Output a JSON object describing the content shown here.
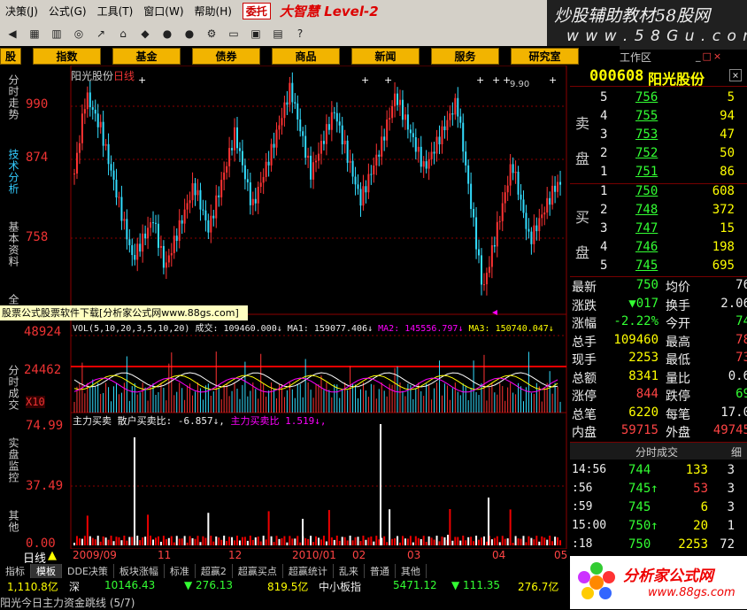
{
  "menu": {
    "items": [
      "决策(J)",
      "公式(G)",
      "工具(T)",
      "窗口(W)",
      "帮助(H)"
    ],
    "wt_label": "委托",
    "brand": "大智慧 Level-2"
  },
  "logo": {
    "line1": "炒股辅助教材58股网",
    "line2": "w w w . 5 8 G u . c o m"
  },
  "nav": {
    "items": [
      "股",
      "指数",
      "基金",
      "债券",
      "商品",
      "新闻",
      "服务",
      "研究室"
    ],
    "workspace": "工作区"
  },
  "side_tabs": [
    "分时走势",
    "技术分析",
    "基本资料",
    "全",
    "分时成交",
    "实盘监控",
    "其他"
  ],
  "chart_header": {
    "name": "阳光股份",
    "period": "日线",
    "peak_label": "9.90"
  },
  "axis": {
    "price_ticks": [
      "990",
      "874",
      "758"
    ],
    "vol_ticks": [
      "48924",
      "24462",
      "X10"
    ],
    "ind_ticks": [
      "74.99",
      "37.49",
      "0.00"
    ]
  },
  "watermark": "股票公式股票软件下载[分析家公式网www.88gs.com]",
  "vol_legend": {
    "vol": "VOL(5,10,20,3,5,10,20) 成交: 109460.000↓",
    "ma1": "MA1: 159077.406↓",
    "ma2": "MA2: 145556.797↓",
    "ma3": "MA3: 150740.047↓"
  },
  "ind_legend": {
    "title": "主力买卖",
    "retail": "散户买卖比: -6.857↓,",
    "main": "主力买卖比  1.519↓,"
  },
  "time_labels": [
    "2009/09",
    "11",
    "12",
    "2010/01",
    "02",
    "03",
    "04",
    "05"
  ],
  "period_label": "日线",
  "bottom_tabs": [
    "指标",
    "模板",
    "DDE决策",
    "板块涨幅",
    "标准",
    "超赢2",
    "超赢买点",
    "超赢统计",
    "乱来",
    "普通",
    "其他"
  ],
  "status": {
    "sh_amt": "1,110.8亿",
    "sz_label": "深",
    "sz_idx": "10146.43",
    "sz_chg": "▼ 276.13",
    "sz_amt": "819.5亿",
    "zx_label": "中小板指",
    "zx_idx": "5471.12",
    "zx_chg": "▼ 111.35",
    "zx_amt": "276.7亿",
    "ticker_text": "阳光今日主力资金跳线 (5/7)"
  },
  "quote": {
    "code": "000608",
    "name": "阳光股份",
    "sell_label": "卖盘",
    "buy_label": "买盘",
    "sell": [
      {
        "n": "5",
        "p": "756",
        "v": "5"
      },
      {
        "n": "4",
        "p": "755",
        "v": "94"
      },
      {
        "n": "3",
        "p": "753",
        "v": "47"
      },
      {
        "n": "2",
        "p": "752",
        "v": "50"
      },
      {
        "n": "1",
        "p": "751",
        "v": "86"
      }
    ],
    "buy": [
      {
        "n": "1",
        "p": "750",
        "v": "608"
      },
      {
        "n": "2",
        "p": "748",
        "v": "372"
      },
      {
        "n": "3",
        "p": "747",
        "v": "15"
      },
      {
        "n": "4",
        "p": "746",
        "v": "198"
      },
      {
        "n": "5",
        "p": "745",
        "v": "695"
      }
    ],
    "stats": [
      {
        "k1": "最新",
        "v1": "750",
        "k2": "均价",
        "v2": "76"
      },
      {
        "k1": "涨跌",
        "v1": "▼017",
        "k2": "换手",
        "v2": "2.06"
      },
      {
        "k1": "涨幅",
        "v1": "-2.22%",
        "k2": "今开",
        "v2": "74"
      },
      {
        "k1": "总手",
        "v1": "109460",
        "k2": "最高",
        "v2": "78"
      },
      {
        "k1": "现手",
        "v1": "2253",
        "k2": "最低",
        "v2": "73"
      },
      {
        "k1": "总额",
        "v1": "8341",
        "k2": "量比",
        "v2": "0.6"
      },
      {
        "k1": "涨停",
        "v1": "844",
        "k2": "跌停",
        "v2": "69"
      },
      {
        "k1": "总笔",
        "v1": "6220",
        "k2": "每笔",
        "v2": "17.0"
      },
      {
        "k1": "内盘",
        "v1": "59715",
        "k2": "外盘",
        "v2": "49745"
      }
    ],
    "tick_title": "分时成交",
    "tick_tab2": "细",
    "ticks": [
      {
        "t": "14:56",
        "p": "744",
        "v": "133",
        "n": "3"
      },
      {
        "t": ":56",
        "p": "745↑",
        "v": "53",
        "n": "3"
      },
      {
        "t": ":59",
        "p": "745",
        "v": "6",
        "n": "3"
      },
      {
        "t": "15:00",
        "p": "750↑",
        "v": "20",
        "n": "1"
      },
      {
        "t": ":18",
        "p": "750",
        "v": "2253",
        "n": "72"
      }
    ]
  },
  "ad": {
    "title": "分析家公式网",
    "url": "www.88gs.com"
  },
  "colors": {
    "up": "#ff3333",
    "down": "#33ddff",
    "grid": "#8b0000",
    "volma1": "#ffffff",
    "volma2": "#ffff00",
    "volma3": "#ff00ff"
  }
}
